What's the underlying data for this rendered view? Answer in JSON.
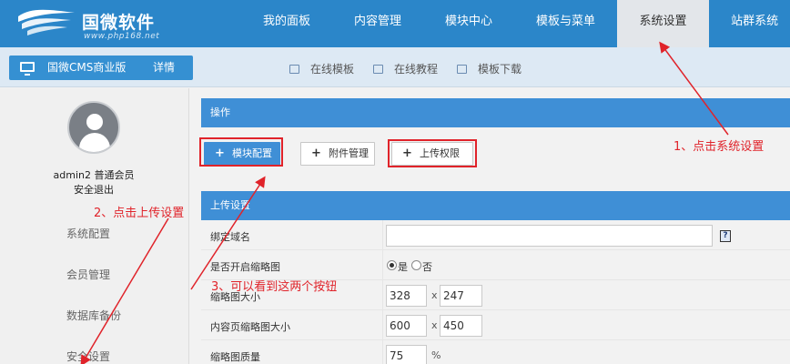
{
  "brand": {
    "title": "国微软件",
    "url": "www.php168.net"
  },
  "nav": [
    {
      "label": "我的面板"
    },
    {
      "label": "内容管理"
    },
    {
      "label": "模块中心"
    },
    {
      "label": "模板与菜单"
    },
    {
      "label": "系统设置",
      "active": true
    },
    {
      "label": "站群系统"
    }
  ],
  "product": {
    "name": "国微CMS商业版",
    "more": "详情>>"
  },
  "quicklinks": [
    {
      "label": "在线模板",
      "icon": "monitor-icon"
    },
    {
      "label": "在线教程",
      "icon": "book-icon"
    },
    {
      "label": "模板下载",
      "icon": "download-icon"
    }
  ],
  "user": {
    "name": "admin2 普通会员",
    "logout": "安全退出"
  },
  "sidebar": {
    "items": [
      {
        "label": "系统配置"
      },
      {
        "label": "会员管理"
      },
      {
        "label": "数据库备份"
      },
      {
        "label": "安全设置"
      }
    ]
  },
  "panel": {
    "ops_title": "操作",
    "upload_title": "上传设置"
  },
  "buttons": {
    "module_config": "模块配置",
    "attachment": "附件管理",
    "upload_perm": "上传权限"
  },
  "form": {
    "domain_label": "绑定域名",
    "domain_value": "",
    "help": "?",
    "thumb_enable_label": "是否开启缩略图",
    "yes": "是",
    "no": "否",
    "thumb_size_label": "缩略图大小",
    "thumb_w": "328",
    "thumb_h": "247",
    "content_thumb_label": "内容页缩略图大小",
    "content_w": "600",
    "content_h": "450",
    "quality_label": "缩略图质量",
    "quality_value": "75",
    "times": "x",
    "percent": "%"
  },
  "annotations": {
    "step1": "1、点击系统设置",
    "step2": "2、点击上传设置",
    "step3": "3、可以看到这两个按钮"
  },
  "colors": {
    "primary": "#2b86c9",
    "accent_red": "#e0232a",
    "panel_blue": "#3f8fd6"
  }
}
